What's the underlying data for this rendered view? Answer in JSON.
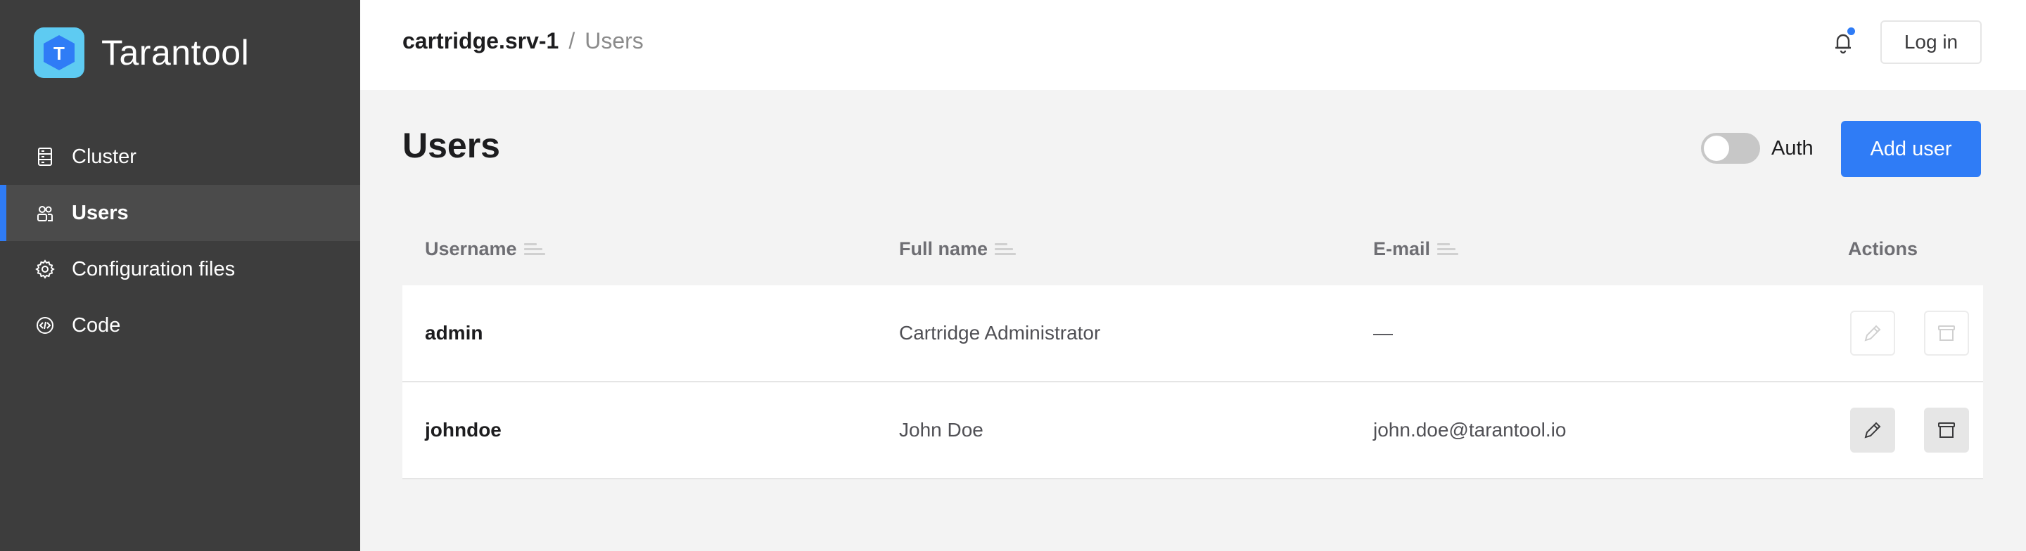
{
  "brand": {
    "name": "Tarantool",
    "logo_letter": "T",
    "logo_color": "#5ecbf2"
  },
  "sidebar": {
    "items": [
      {
        "label": "Cluster",
        "icon": "cluster-icon",
        "active": false
      },
      {
        "label": "Users",
        "icon": "users-icon",
        "active": true
      },
      {
        "label": "Configuration files",
        "icon": "gear-icon",
        "active": false
      },
      {
        "label": "Code",
        "icon": "code-icon",
        "active": false
      }
    ]
  },
  "header": {
    "breadcrumb": {
      "server": "cartridge.srv-1",
      "separator": "/",
      "page": "Users"
    },
    "notifications_icon": "bell-icon",
    "login_label": "Log in"
  },
  "main": {
    "title": "Users",
    "auth_toggle": {
      "label": "Auth",
      "on": false
    },
    "add_user_label": "Add user",
    "accent_color": "#2f7cf6"
  },
  "table": {
    "columns": [
      "Username",
      "Full name",
      "E-mail",
      "Actions"
    ],
    "rows": [
      {
        "username": "admin",
        "full_name": "Cartridge Administrator",
        "email": "—",
        "actions_enabled": false
      },
      {
        "username": "johndoe",
        "full_name": "John Doe",
        "email": "john.doe@tarantool.io",
        "actions_enabled": true
      }
    ]
  }
}
